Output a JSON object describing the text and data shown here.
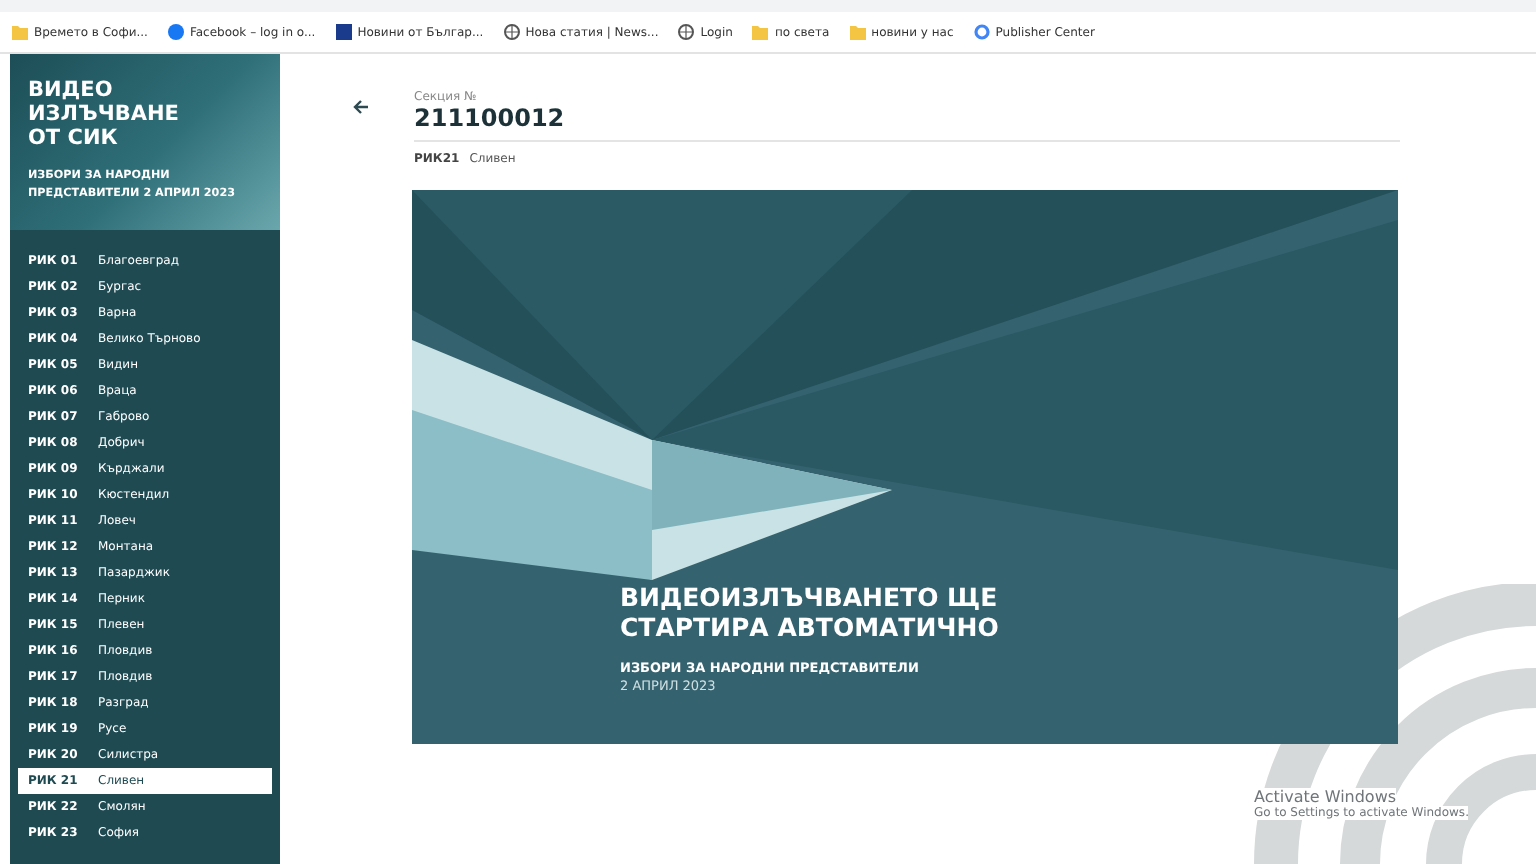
{
  "bookmarks": [
    {
      "label": "Времето в Софи...",
      "kind": "folder"
    },
    {
      "label": "Facebook – log in o...",
      "kind": "social"
    },
    {
      "label": "Новини от Българ...",
      "kind": "square"
    },
    {
      "label": "Нова статия | News...",
      "kind": "globe"
    },
    {
      "label": "Login",
      "kind": "globe"
    },
    {
      "label": "по света",
      "kind": "folder"
    },
    {
      "label": "новини у нас",
      "kind": "folder"
    },
    {
      "label": "Publisher Center",
      "kind": "g"
    }
  ],
  "sidebar": {
    "title": "ВИДЕО ИЗЛЪЧВАНЕ ОТ СИК",
    "subtitle": "ИЗБОРИ ЗА НАРОДНИ ПРЕДСТАВИТЕЛИ 2 АПРИЛ 2023",
    "items": [
      {
        "code": "РИК 01",
        "name": "Благоевград",
        "selected": false
      },
      {
        "code": "РИК 02",
        "name": "Бургас",
        "selected": false
      },
      {
        "code": "РИК 03",
        "name": "Варна",
        "selected": false
      },
      {
        "code": "РИК 04",
        "name": "Велико Търново",
        "selected": false
      },
      {
        "code": "РИК 05",
        "name": "Видин",
        "selected": false
      },
      {
        "code": "РИК 06",
        "name": "Враца",
        "selected": false
      },
      {
        "code": "РИК 07",
        "name": "Габрово",
        "selected": false
      },
      {
        "code": "РИК 08",
        "name": "Добрич",
        "selected": false
      },
      {
        "code": "РИК 09",
        "name": "Кърджали",
        "selected": false
      },
      {
        "code": "РИК 10",
        "name": "Кюстендил",
        "selected": false
      },
      {
        "code": "РИК 11",
        "name": "Ловеч",
        "selected": false
      },
      {
        "code": "РИК 12",
        "name": "Монтана",
        "selected": false
      },
      {
        "code": "РИК 13",
        "name": "Пазарджик",
        "selected": false
      },
      {
        "code": "РИК 14",
        "name": "Перник",
        "selected": false
      },
      {
        "code": "РИК 15",
        "name": "Плевен",
        "selected": false
      },
      {
        "code": "РИК 16",
        "name": "Пловдив",
        "selected": false
      },
      {
        "code": "РИК 17",
        "name": "Пловдив",
        "selected": false
      },
      {
        "code": "РИК 18",
        "name": "Разград",
        "selected": false
      },
      {
        "code": "РИК 19",
        "name": "Русе",
        "selected": false
      },
      {
        "code": "РИК 20",
        "name": "Силистра",
        "selected": false
      },
      {
        "code": "РИК 21",
        "name": "Сливен",
        "selected": true
      },
      {
        "code": "РИК 22",
        "name": "Смолян",
        "selected": false
      },
      {
        "code": "РИК 23",
        "name": "София",
        "selected": false
      }
    ]
  },
  "section": {
    "label": "Секция №",
    "number": "211100012",
    "rik": "РИК21",
    "city": "Сливен"
  },
  "video": {
    "headline": "ВИДЕОИЗЛЪЧВАНЕТО ЩЕ СТАРТИРА АВТОМАТИЧНО",
    "subtitle": "ИЗБОРИ ЗА НАРОДНИ ПРЕДСТАВИТЕЛИ",
    "date": "2 АПРИЛ 2023"
  },
  "activation": {
    "title": "Activate Windows",
    "text": "Go to Settings to activate Windows."
  }
}
